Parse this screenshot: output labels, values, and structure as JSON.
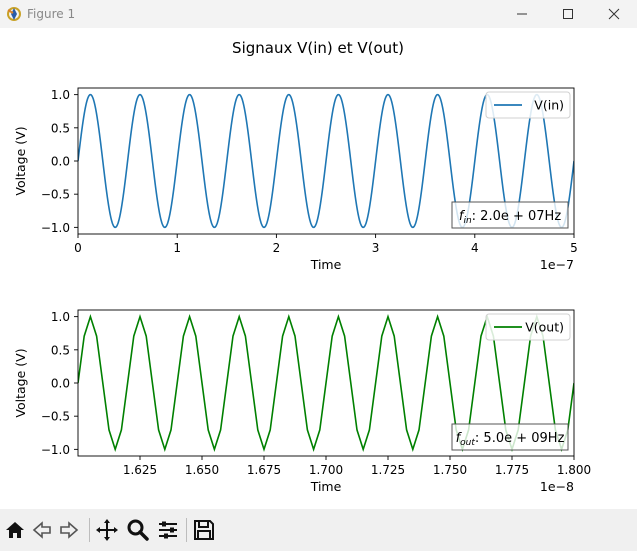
{
  "window": {
    "title": "Figure 1",
    "icons": {
      "minimize": "minimize-icon",
      "maximize": "maximize-icon",
      "close": "close-icon"
    }
  },
  "figure": {
    "suptitle": "Signaux V(in) et V(out)"
  },
  "toolbar": {
    "buttons": [
      "home-icon",
      "back-arrow-icon",
      "forward-arrow-icon",
      "pan-icon",
      "zoom-icon",
      "configure-subplots-icon",
      "save-icon"
    ]
  },
  "colors": {
    "vin": "#1f77b4",
    "vout": "#008000"
  },
  "chart_data": [
    {
      "type": "line",
      "title": "",
      "xlabel": "Time",
      "ylabel": "Voltage (V)",
      "xlim": [
        0,
        5e-07
      ],
      "ylim": [
        -1.1,
        1.1
      ],
      "x_ticks": [
        "0",
        "1",
        "2",
        "3",
        "4",
        "5"
      ],
      "x_tick_values": [
        0,
        1e-07,
        2e-07,
        3e-07,
        4e-07,
        5e-07
      ],
      "x_offset_label": "1e−7",
      "y_ticks": [
        "1.0",
        "0.5",
        "0.0",
        "−0.5",
        "−1.0"
      ],
      "y_tick_values": [
        1.0,
        0.5,
        0.0,
        -0.5,
        -1.0
      ],
      "legend": "upper right",
      "series": [
        {
          "name": "V(in)",
          "function": "sin(2*pi*f*t)",
          "frequency_hz": 20000000.0,
          "amplitude": 1.0
        }
      ],
      "annotation": {
        "main": "f",
        "sub": "in",
        "rest": ": 2.0e + 07Hz"
      }
    },
    {
      "type": "line",
      "title": "",
      "xlabel": "Time",
      "ylabel": "Voltage (V)",
      "xlim": [
        1.6e-08,
        1.8e-08
      ],
      "ylim": [
        -1.1,
        1.1
      ],
      "x_ticks": [
        "1.625",
        "1.650",
        "1.675",
        "1.700",
        "1.725",
        "1.750",
        "1.775",
        "1.800"
      ],
      "x_tick_values": [
        1.625e-08,
        1.65e-08,
        1.675e-08,
        1.7e-08,
        1.725e-08,
        1.75e-08,
        1.775e-08,
        1.8e-08
      ],
      "x_offset_label": "1e−8",
      "y_ticks": [
        "1.0",
        "0.5",
        "0.0",
        "−0.5",
        "−1.0"
      ],
      "y_tick_values": [
        1.0,
        0.5,
        0.0,
        -0.5,
        -1.0
      ],
      "legend": "upper right",
      "series": [
        {
          "name": "V(out)",
          "function": "sin(2*pi*f*t)",
          "frequency_hz": 5000000000.0,
          "amplitude": 1.0,
          "sample_step_s": 2.5e-11
        }
      ],
      "annotation": {
        "main": "f",
        "sub": "out",
        "rest": ": 5.0e + 09Hz"
      }
    }
  ]
}
